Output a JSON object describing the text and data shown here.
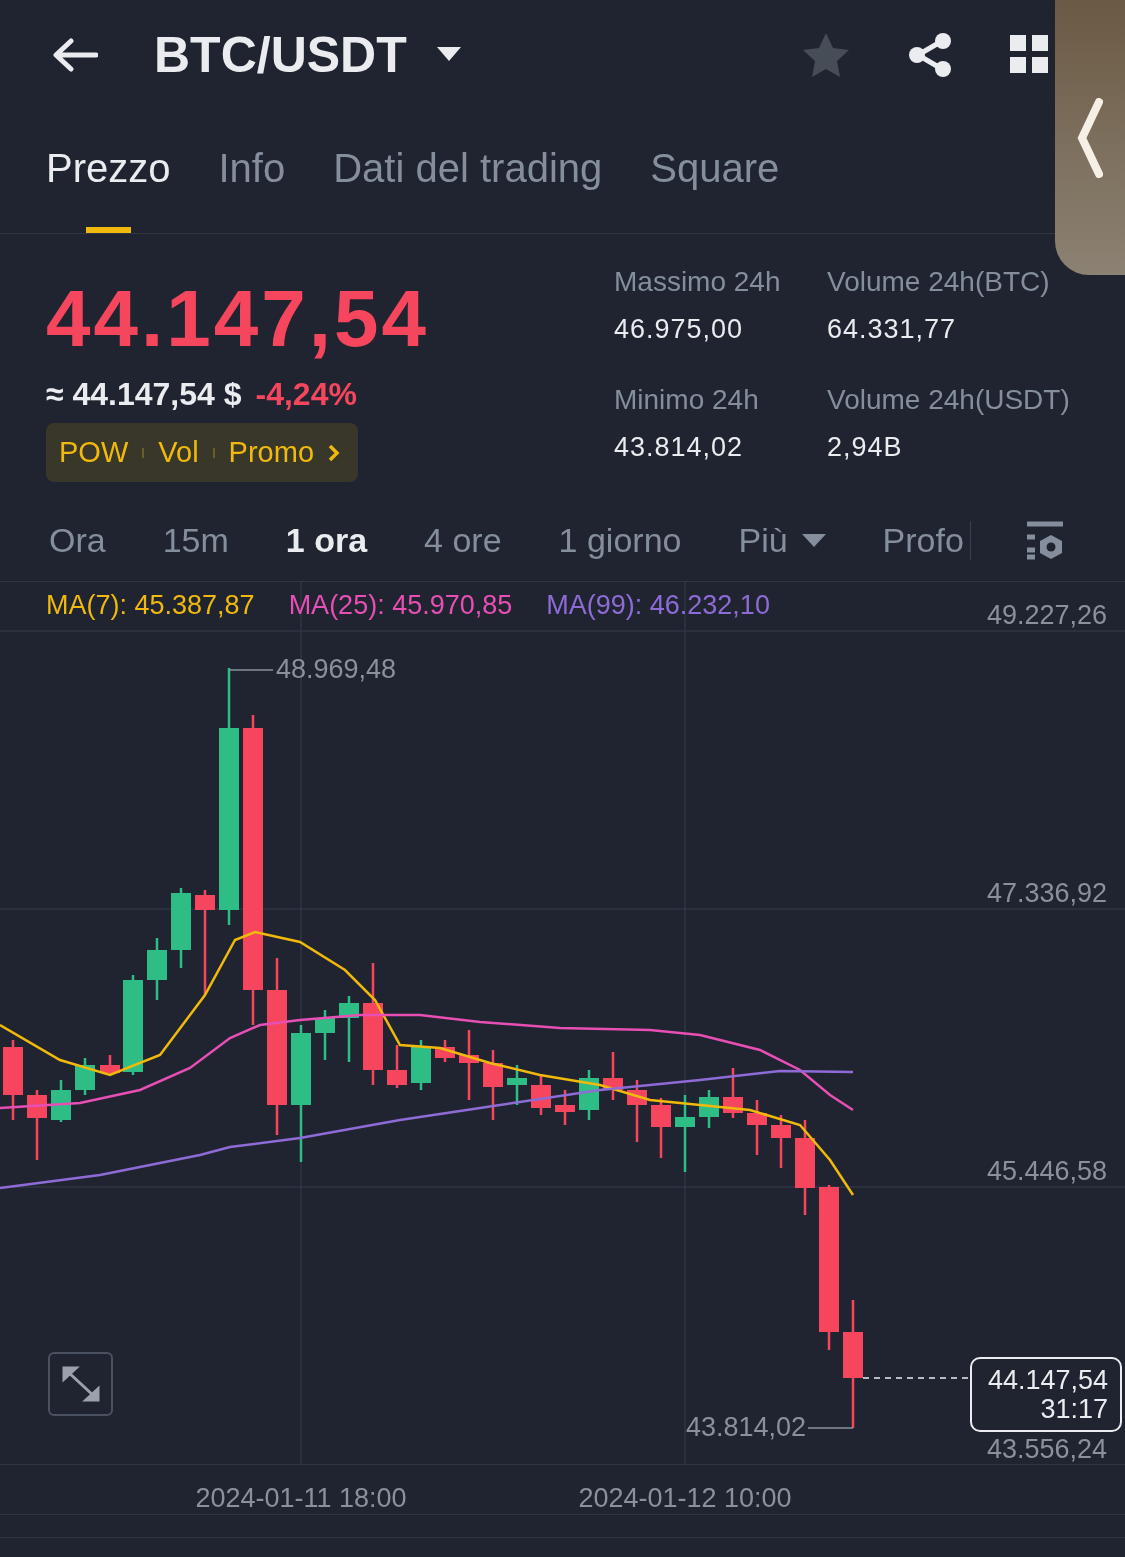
{
  "header": {
    "title": "BTC/USDT"
  },
  "tabs": [
    {
      "label": "Prezzo",
      "selected": true
    },
    {
      "label": "Info",
      "selected": false
    },
    {
      "label": "Dati del trading",
      "selected": false
    },
    {
      "label": "Square",
      "selected": false
    }
  ],
  "price": {
    "last": "44.147,54",
    "approx": "≈ 44.147,54 $",
    "change": "-4,24%"
  },
  "tags": [
    "POW",
    "Vol",
    "Promo"
  ],
  "stats": [
    {
      "label": "Massimo 24h",
      "value": "46.975,00"
    },
    {
      "label": "Volume 24h(BTC)",
      "value": "64.331,77"
    },
    {
      "label": "Minimo 24h",
      "value": "43.814,02"
    },
    {
      "label": "Volume 24h(USDT)",
      "value": "2,94B"
    }
  ],
  "intervals": [
    {
      "label": "Ora",
      "kind": "option",
      "selected": false
    },
    {
      "label": "15m",
      "kind": "option",
      "selected": false
    },
    {
      "label": "1 ora",
      "kind": "option",
      "selected": true
    },
    {
      "label": "4 ore",
      "kind": "option",
      "selected": false
    },
    {
      "label": "1 giorno",
      "kind": "option",
      "selected": false
    },
    {
      "label": "Più",
      "kind": "dropdown",
      "selected": false
    },
    {
      "label": "Profo",
      "kind": "option",
      "selected": false
    }
  ],
  "chart": {
    "moving_averages": [
      {
        "label": "MA(7): 45.387,87",
        "color": "#f0b90b"
      },
      {
        "label": "MA(25): 45.970,85",
        "color": "#e84fb5"
      },
      {
        "label": "MA(99): 46.232,10",
        "color": "#8e6bd6"
      }
    ],
    "y_labels": [
      "49.227,26",
      "47.336,92",
      "45.446,58",
      "43.556,24"
    ],
    "high_label": "48.969,48",
    "low_label": "43.814,02",
    "current_price": "44.147,54",
    "countdown": "31:17",
    "x_labels": [
      "2024-01-11 18:00",
      "2024-01-12 10:00"
    ]
  }
}
